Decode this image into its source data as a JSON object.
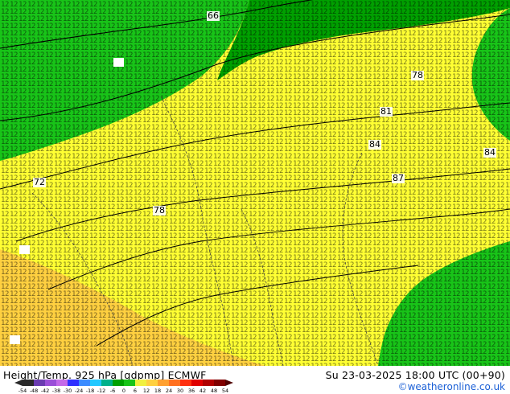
{
  "map": {
    "title": "Height/Temp. 925 hPa [gdpmp] ECMWF",
    "valid_time": "Su 23-03-2025 18:00 UTC (00+90)",
    "credit": "©weatheronline.co.uk",
    "contour_labels": [
      "66",
      "72",
      "78",
      "78",
      "81",
      "84",
      "84",
      "87"
    ],
    "colorbar_ticks": [
      "-54",
      "-48",
      "-42",
      "-38",
      "-30",
      "-24",
      "-18",
      "-12",
      "-6",
      "0",
      "6",
      "12",
      "18",
      "24",
      "30",
      "36",
      "42",
      "48",
      "54"
    ],
    "colors": {
      "green_dark": "#00a000",
      "green": "#18c418",
      "yellow": "#ffff33",
      "orange_light": "#ffd040"
    }
  }
}
